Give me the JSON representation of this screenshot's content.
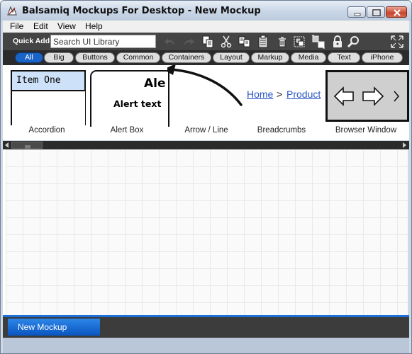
{
  "window": {
    "title": "Balsamiq Mockups For Desktop - New Mockup"
  },
  "menu": {
    "items": [
      "File",
      "Edit",
      "View",
      "Help"
    ]
  },
  "toolbar": {
    "quick_add_label": "Quick Add:",
    "search_placeholder": "Search UI Library",
    "icons": [
      "undo-icon",
      "redo-icon",
      "copy-icon",
      "cut-icon",
      "duplicate-icon",
      "paste-icon",
      "delete-icon",
      "group-icon",
      "ungroup-icon",
      "lock-icon",
      "search-icon",
      "fullscreen-icon"
    ]
  },
  "filters": {
    "items": [
      "All",
      "Big",
      "Buttons",
      "Common",
      "Containers",
      "Layout",
      "Markup",
      "Media",
      "Text",
      "iPhone"
    ],
    "active": "All"
  },
  "library": {
    "accordion": {
      "label": "Accordion",
      "item": "Item One"
    },
    "alert_box": {
      "label": "Alert Box",
      "title": "Ale",
      "text": "Alert text"
    },
    "arrow_line": {
      "label": "Arrow / Line"
    },
    "breadcrumbs": {
      "label": "Breadcrumbs",
      "first": "Home",
      "separator": ">",
      "second": "Product"
    },
    "browser_window": {
      "label": "Browser Window"
    }
  },
  "tabs": {
    "active": "New Mockup"
  },
  "colors": {
    "accent": "#1b64c7",
    "toolbar_bg": "#444444",
    "filterbar_bg": "#2b2b2b",
    "link": "#2a56c6"
  }
}
